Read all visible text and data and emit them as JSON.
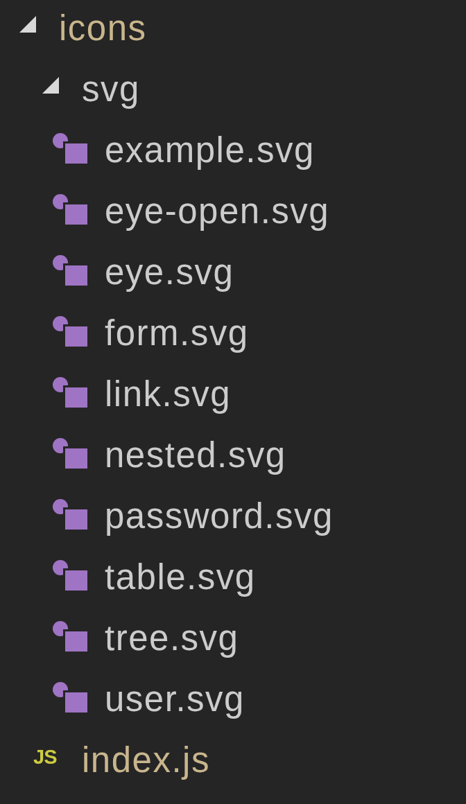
{
  "explorer": {
    "tree": [
      {
        "name": "icons",
        "kind": "folder",
        "expanded": true,
        "color": "#c9b68c",
        "children": [
          {
            "name": "svg",
            "kind": "folder",
            "expanded": true,
            "color": "#cccccc",
            "children": [
              {
                "name": "example.svg",
                "kind": "svg",
                "color": "#cccccc"
              },
              {
                "name": "eye-open.svg",
                "kind": "svg",
                "color": "#cccccc"
              },
              {
                "name": "eye.svg",
                "kind": "svg",
                "color": "#cccccc"
              },
              {
                "name": "form.svg",
                "kind": "svg",
                "color": "#cccccc"
              },
              {
                "name": "link.svg",
                "kind": "svg",
                "color": "#cccccc"
              },
              {
                "name": "nested.svg",
                "kind": "svg",
                "color": "#cccccc"
              },
              {
                "name": "password.svg",
                "kind": "svg",
                "color": "#cccccc"
              },
              {
                "name": "table.svg",
                "kind": "svg",
                "color": "#cccccc"
              },
              {
                "name": "tree.svg",
                "kind": "svg",
                "color": "#cccccc"
              },
              {
                "name": "user.svg",
                "kind": "svg",
                "color": "#cccccc"
              }
            ]
          },
          {
            "name": "index.js",
            "kind": "js",
            "badge": "JS",
            "color": "#c9b68c"
          }
        ]
      }
    ]
  }
}
